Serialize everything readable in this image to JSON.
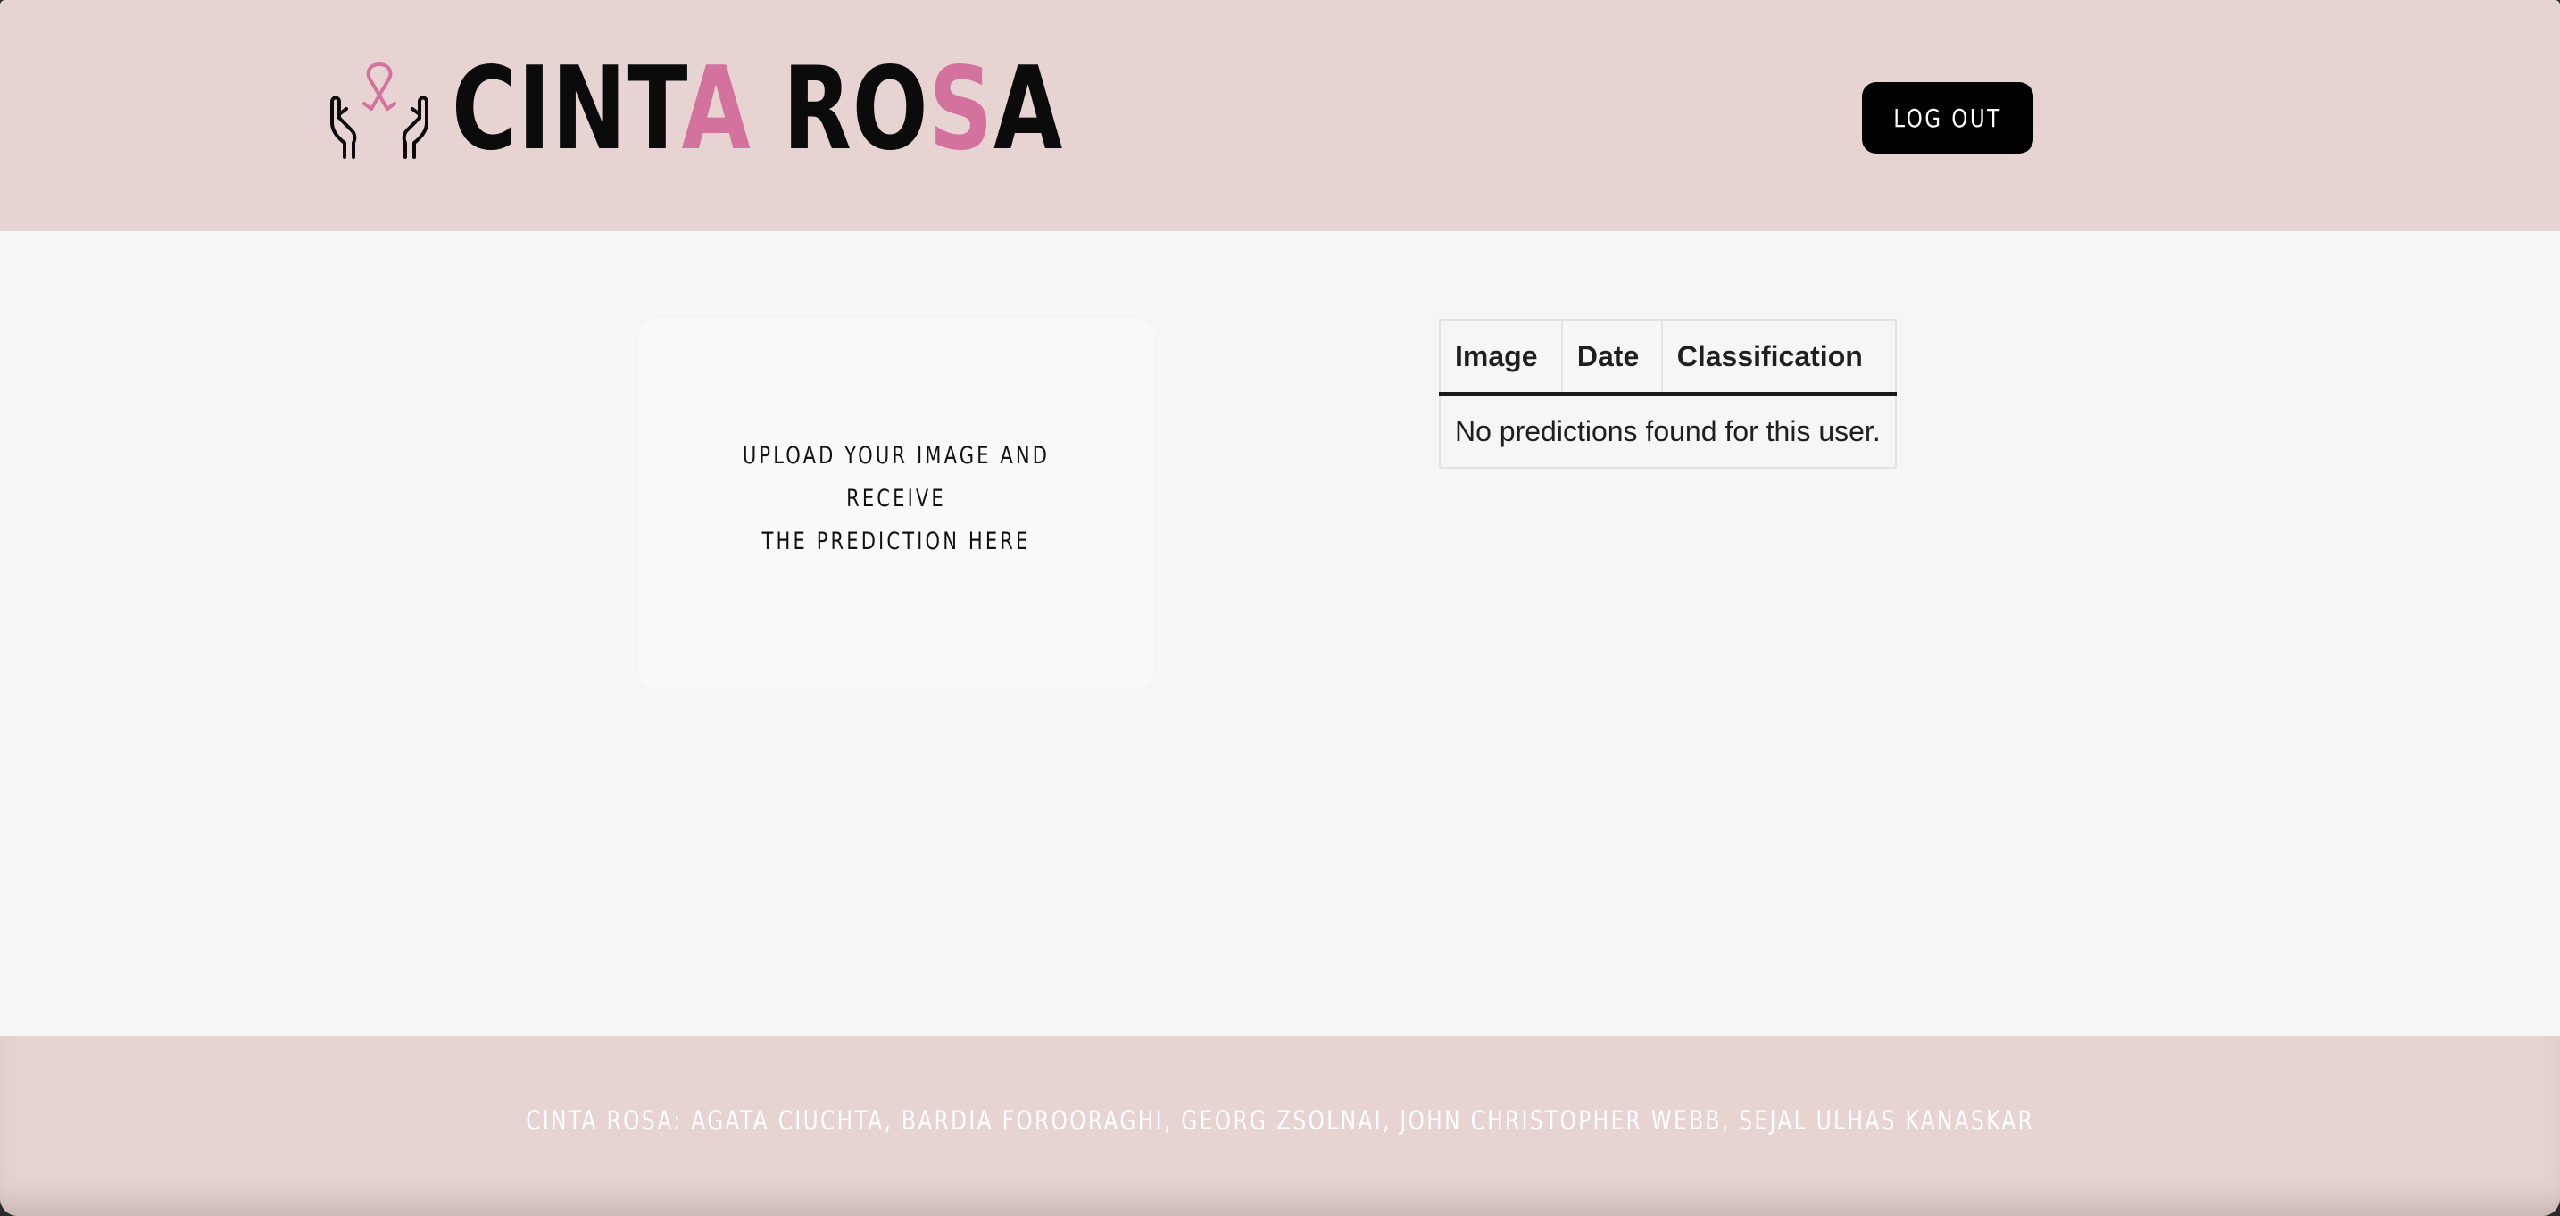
{
  "header": {
    "brand": {
      "part1": "CINT",
      "part2": "A",
      "part3": " RO",
      "part4": "S",
      "part5": "A",
      "icon": "hands-ribbon-icon"
    },
    "logout_label": "LOG OUT"
  },
  "upload": {
    "line1": "UPLOAD YOUR IMAGE AND RECEIVE",
    "line2": "THE PREDICTION HERE"
  },
  "predictions": {
    "columns": [
      "Image",
      "Date",
      "Classification"
    ],
    "empty_message": "No predictions found for this user."
  },
  "footer": {
    "credits": "CINTA ROSA: AGATA CIUCHTA, BARDIA FOROORAGHI, GEORG ZSOLNAI, JOHN CHRISTOPHER WEBB, SEJAL ULHAS KANASKAR"
  },
  "colors": {
    "header_bg": "#e7d4d2",
    "brand_pink": "#d4729e",
    "page_bg": "#f6f6f6",
    "button_bg": "#000000"
  }
}
